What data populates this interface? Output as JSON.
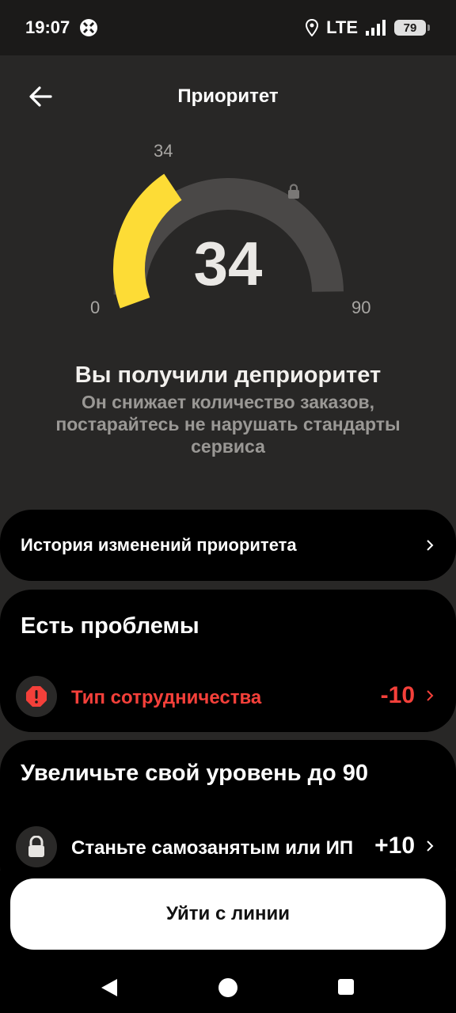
{
  "status_bar": {
    "time": "19:07",
    "network": "LTE",
    "battery": "79"
  },
  "header": {
    "title": "Приоритет"
  },
  "gauge": {
    "current_label": "34",
    "value": "34",
    "min_label": "0",
    "max_label": "90",
    "current": 34,
    "max": 90,
    "fill_color": "#fddc36",
    "track_color": "#4a4847"
  },
  "message": {
    "heading": "Вы получили деприоритет",
    "subtext": "Он снижает количество заказов, постарайтесь не нарушать стандарты сервиса"
  },
  "history": {
    "label": "История изменений приоритета"
  },
  "problems": {
    "title": "Есть проблемы",
    "items": [
      {
        "label": "Тип сотрудничества",
        "value": "-10"
      }
    ]
  },
  "level_up": {
    "title": "Увеличьте свой уровень до 90",
    "items": [
      {
        "label": "Станьте самозанятым или ИП",
        "value": "+10"
      }
    ]
  },
  "actions": {
    "leave_line": "Уйти с линии"
  },
  "colors": {
    "accent": "#fddc36",
    "danger": "#f4403a",
    "background": "#282726"
  }
}
